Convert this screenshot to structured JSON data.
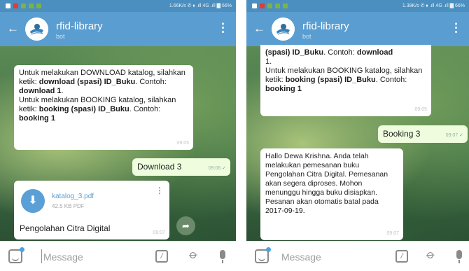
{
  "left": {
    "status_right": "1.66K/s ✆ ⬧ .ıll 4G .ıll ▇ 66%",
    "chat": {
      "title": "rfid-library",
      "subtitle": "bot",
      "back_icon": "arrow-left-icon",
      "menu_icon": "more-vertical-icon"
    },
    "messages": {
      "m1": {
        "p1": "Untuk melakukan DOWNLOAD katalog, silahkan ketik: ",
        "b1": "download (spasi) ID_Buku",
        "p2": ". Contoh: ",
        "b2": "download 1",
        "p3": ".",
        "p4": "Untuk melakukan BOOKING katalog, silahkan ketik: ",
        "b3": "booking (spasi) ID_Buku",
        "p5": ". Contoh: ",
        "b4": "booking 1",
        "time": "09:05"
      },
      "m2": {
        "text": "Download 3",
        "time": "09:06"
      },
      "m3": {
        "file_name": "katalog_3.pdf",
        "file_size": "42.5 KB PDF",
        "caption": "Pengolahan Citra Digital",
        "time": "09:07",
        "file_icon": "download-icon"
      }
    },
    "input": {
      "placeholder": "Message"
    }
  },
  "right": {
    "status_right": "1.38K/s ✆ ⬧ .ıll 4G .ıll ▇ 66%",
    "chat": {
      "title": "rfid-library",
      "subtitle": "bot"
    },
    "messages": {
      "m1": {
        "top": "(spasi) ID_Buku",
        "top2": ". Contoh: ",
        "top3": "download",
        "line1": "1.",
        "p4": "Untuk melakukan BOOKING katalog, silahkan ketik: ",
        "b3": "booking (spasi) ID_Buku",
        "p5": ". Contoh: ",
        "b4": "booking 1",
        "time": "09:05"
      },
      "m2": {
        "text": "Booking 3",
        "time": "09:07"
      },
      "m3": {
        "text": "Hallo Dewa Krishna. Anda telah melakukan pemesanan buku Pengolahan Citra Digital. Pemesanan akan segera diproses. Mohon menunggu hingga buku disiapkan. Pesanan akan otomatis batal pada 2017-09-19.",
        "time": "09:07"
      }
    },
    "input": {
      "placeholder": "Message"
    }
  },
  "colors": {
    "app_bar": "#5a9dd1",
    "status_bar": "#4a8fbf",
    "outgoing_bubble": "#effdde",
    "accent": "#5aa0d7"
  }
}
